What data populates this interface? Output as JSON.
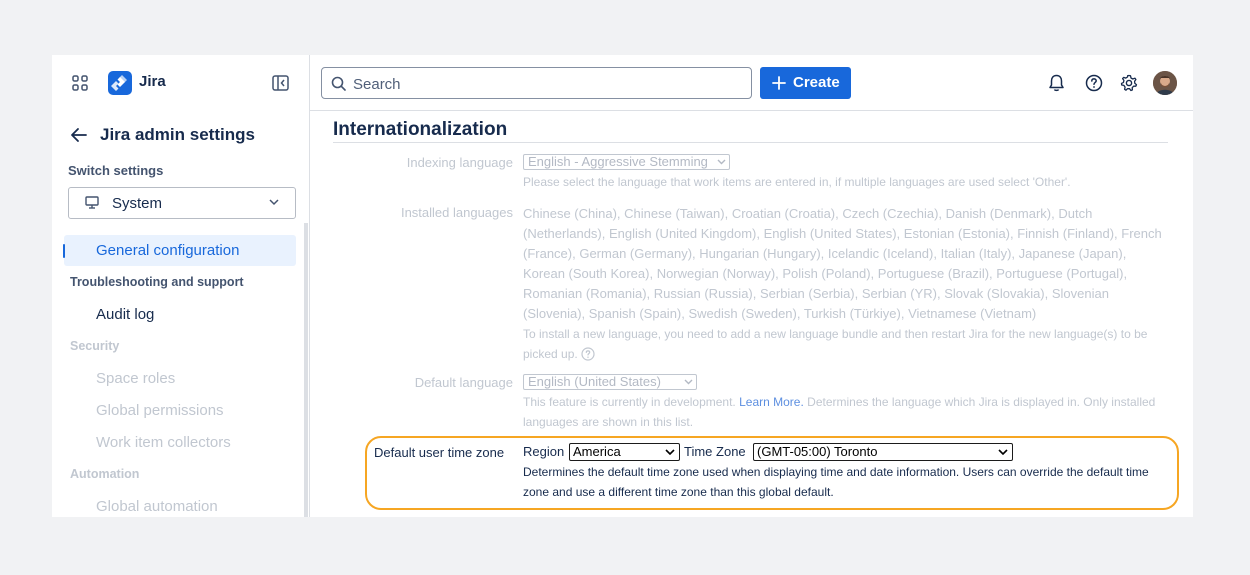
{
  "sidebar": {
    "brand": "Jira",
    "admin_title": "Jira admin settings",
    "switch_label": "Switch settings",
    "switch_value": "System",
    "nav": [
      {
        "type": "item",
        "label": "General configuration",
        "active": true
      },
      {
        "type": "heading",
        "label": "Troubleshooting and support"
      },
      {
        "type": "item",
        "label": "Audit log"
      },
      {
        "type": "heading",
        "label": "Security",
        "dim": true
      },
      {
        "type": "item",
        "label": "Space roles",
        "dim": true
      },
      {
        "type": "item",
        "label": "Global permissions",
        "dim": true
      },
      {
        "type": "item",
        "label": "Work item collectors",
        "dim": true
      },
      {
        "type": "heading",
        "label": "Automation",
        "dim": true
      },
      {
        "type": "item",
        "label": "Global automation",
        "dim": true
      }
    ]
  },
  "topbar": {
    "search_placeholder": "Search",
    "create_label": "Create",
    "icons": [
      "bell-icon",
      "help-icon",
      "gear-icon",
      "avatar"
    ]
  },
  "main": {
    "title": "Internationalization",
    "indexing": {
      "label": "Indexing language",
      "value": "English - Aggressive Stemming",
      "help": "Please select the language that work items are entered in, if multiple languages are used select 'Other'."
    },
    "installed": {
      "label": "Installed languages",
      "list": "Chinese (China), Chinese (Taiwan), Croatian (Croatia), Czech (Czechia), Danish (Denmark), Dutch (Netherlands), English (United Kingdom), English (United States), Estonian (Estonia), Finnish (Finland), French (France), German (Germany), Hungarian (Hungary), Icelandic (Iceland), Italian (Italy), Japanese (Japan), Korean (South Korea), Norwegian (Norway), Polish (Poland), Portuguese (Brazil), Portuguese (Portugal), Romanian (Romania), Russian (Russia), Serbian (Serbia), Serbian (YR), Slovak (Slovakia), Slovenian (Slovenia), Spanish (Spain), Swedish (Sweden), Turkish (Türkiye), Vietnamese (Vietnam)",
      "help": "To install a new language, you need to add a new language bundle and then restart Jira for the new language(s) to be picked up."
    },
    "default_language": {
      "label": "Default language",
      "value": "English (United States)",
      "help_prefix": "This feature is currently in development.",
      "help_link": "Learn More.",
      "help_suffix": "Determines the language which Jira is displayed in. Only installed languages are shown in this list."
    },
    "timezone": {
      "label": "Default user time zone",
      "region_label": "Region",
      "region_value": "America",
      "tz_label": "Time Zone",
      "tz_value": "(GMT-05:00) Toronto",
      "help": "Determines the default time zone used when displaying time and date information. Users can override the default time zone and use a different time zone than this global default."
    }
  },
  "colors": {
    "accent": "#1868db",
    "highlight": "#f6a623",
    "active_bg": "#e9f2fe"
  }
}
